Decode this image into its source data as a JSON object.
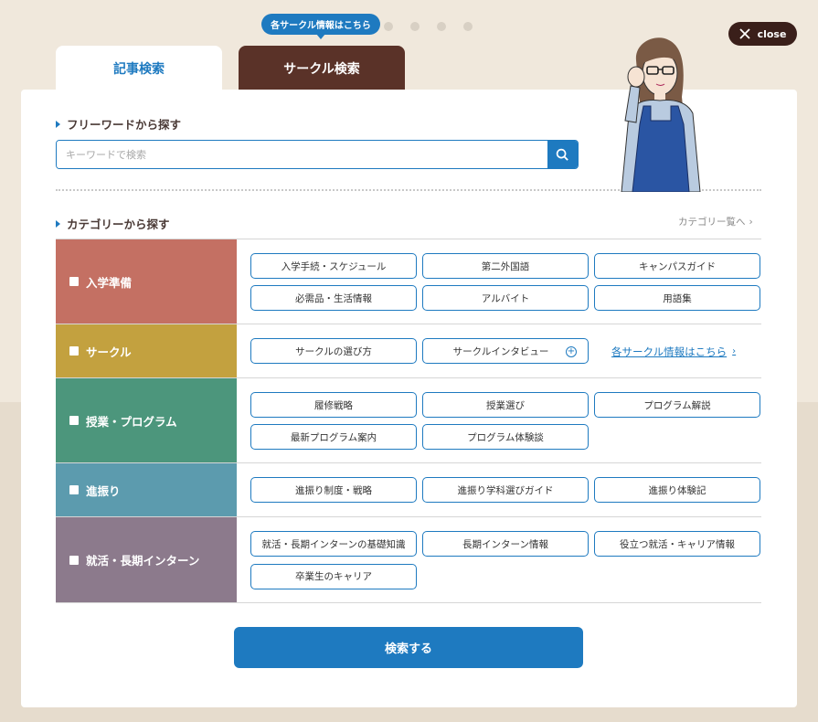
{
  "close_label": "close",
  "tabs": {
    "article": "記事検索",
    "circle": "サークル検索",
    "tooltip": "各サークル情報はこちら"
  },
  "freeword": {
    "title": "フリーワードから探す",
    "placeholder": "キーワードで検索"
  },
  "category": {
    "title": "カテゴリーから探す",
    "list_link": "カテゴリー覧へ"
  },
  "categories": [
    {
      "label": "入学準備",
      "color": "#c47063",
      "items": [
        "入学手続・スケジュール",
        "第二外国語",
        "キャンパスガイド",
        "必需品・生活情報",
        "アルバイト",
        "用語集"
      ]
    },
    {
      "label": "サークル",
      "color": "#c3a13f",
      "items": [
        "サークルの選び方",
        "サークルインタビュー"
      ],
      "link": "各サークル情報はこちら"
    },
    {
      "label": "授業・プログラム",
      "color": "#4c967c",
      "items": [
        "履修戦略",
        "授業選び",
        "プログラム解説",
        "最新プログラム案内",
        "プログラム体験談"
      ]
    },
    {
      "label": "進振り",
      "color": "#5c9bae",
      "items": [
        "進振り制度・戦略",
        "進振り学科選びガイド",
        "進振り体験記"
      ]
    },
    {
      "label": "就活・長期インターン",
      "color": "#8c7a8c",
      "items": [
        "就活・長期インターンの基礎知識",
        "長期インターン情報",
        "役立つ就活・キャリア情報",
        "卒業生のキャリア"
      ]
    }
  ],
  "submit_label": "検索する"
}
